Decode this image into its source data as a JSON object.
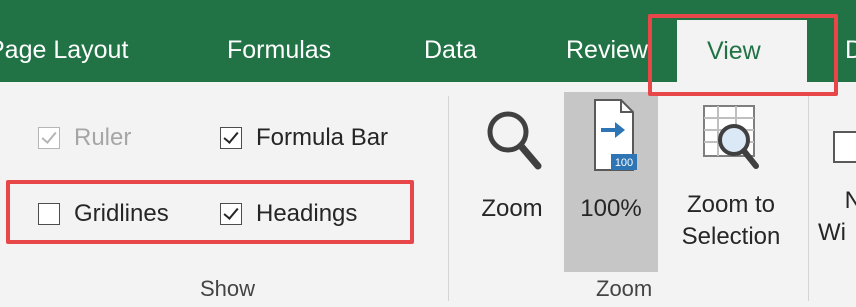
{
  "tabs": {
    "page_layout": "Page Layout",
    "formulas": "Formulas",
    "data": "Data",
    "review": "Review",
    "view": "View",
    "next_clipped": "D"
  },
  "show_group": {
    "label": "Show",
    "ruler": {
      "label": "Ruler",
      "checked": true,
      "enabled": false
    },
    "formula_bar": {
      "label": "Formula Bar",
      "checked": true,
      "enabled": true
    },
    "gridlines": {
      "label": "Gridlines",
      "checked": false,
      "enabled": true
    },
    "headings": {
      "label": "Headings",
      "checked": true,
      "enabled": true
    }
  },
  "zoom_group": {
    "label": "Zoom",
    "zoom_button": "Zoom",
    "hundred_button": "100%",
    "hundred_badge": "100",
    "zoom_to_selection_line1": "Zoom to",
    "zoom_to_selection_line2": "Selection"
  },
  "window_group_clipped": {
    "line1": "N",
    "line2": "Wi"
  },
  "colors": {
    "tab_bar": "#217346",
    "highlight": "#e8474a",
    "ribbon": "#f3f3f3"
  }
}
